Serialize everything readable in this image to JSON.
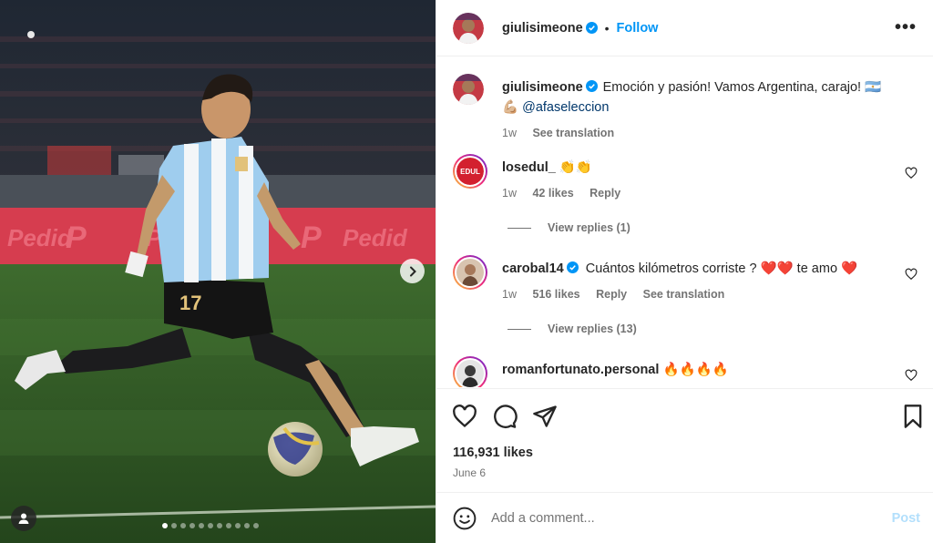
{
  "post": {
    "author": "giulisimeone",
    "follow_label": "Follow",
    "separator": "•",
    "more_label": "•••",
    "caption_text": "Emoción y pasión! Vamos Argentina, carajo! 🇦🇷",
    "caption_emoji": "💪🏼",
    "caption_mention": "@afaseleccion",
    "caption_time": "1w",
    "see_translation": "See translation",
    "likes": "116,931 likes",
    "date": "June 6",
    "carousel_count": 11,
    "carousel_active": 1
  },
  "comments": [
    {
      "username": "losedul_",
      "text": "👏👏",
      "time": "1w",
      "likes": "42 likes",
      "reply_label": "Reply",
      "view_replies": "View replies (1)",
      "avatar_text": "EDUL"
    },
    {
      "username": "carobal14",
      "text": "Cuántos kilómetros corriste ? ❤️❤️ te amo ❤️",
      "time": "1w",
      "likes": "516 likes",
      "reply_label": "Reply",
      "translation": "See translation",
      "view_replies": "View replies (13)"
    },
    {
      "username": "romanfortunato.personal",
      "text": "🔥🔥🔥🔥"
    }
  ],
  "add_comment": {
    "placeholder": "Add a comment...",
    "post_label": "Post"
  },
  "photo": {
    "ad_text": "Pedid",
    "ad_logo": "P",
    "shirt_number": "17"
  },
  "colors": {
    "accent": "#0095f6",
    "post_disabled": "#b2dffc",
    "secondary_text": "#737373",
    "mention": "#00376b"
  },
  "icons": {
    "carousel_next": "chevron-right-icon",
    "tag": "user-tag-icon",
    "like": "heart-icon",
    "comment": "comment-icon",
    "share": "send-icon",
    "save": "bookmark-icon",
    "emoji": "emoji-icon",
    "verified": "verified-badge-icon"
  }
}
